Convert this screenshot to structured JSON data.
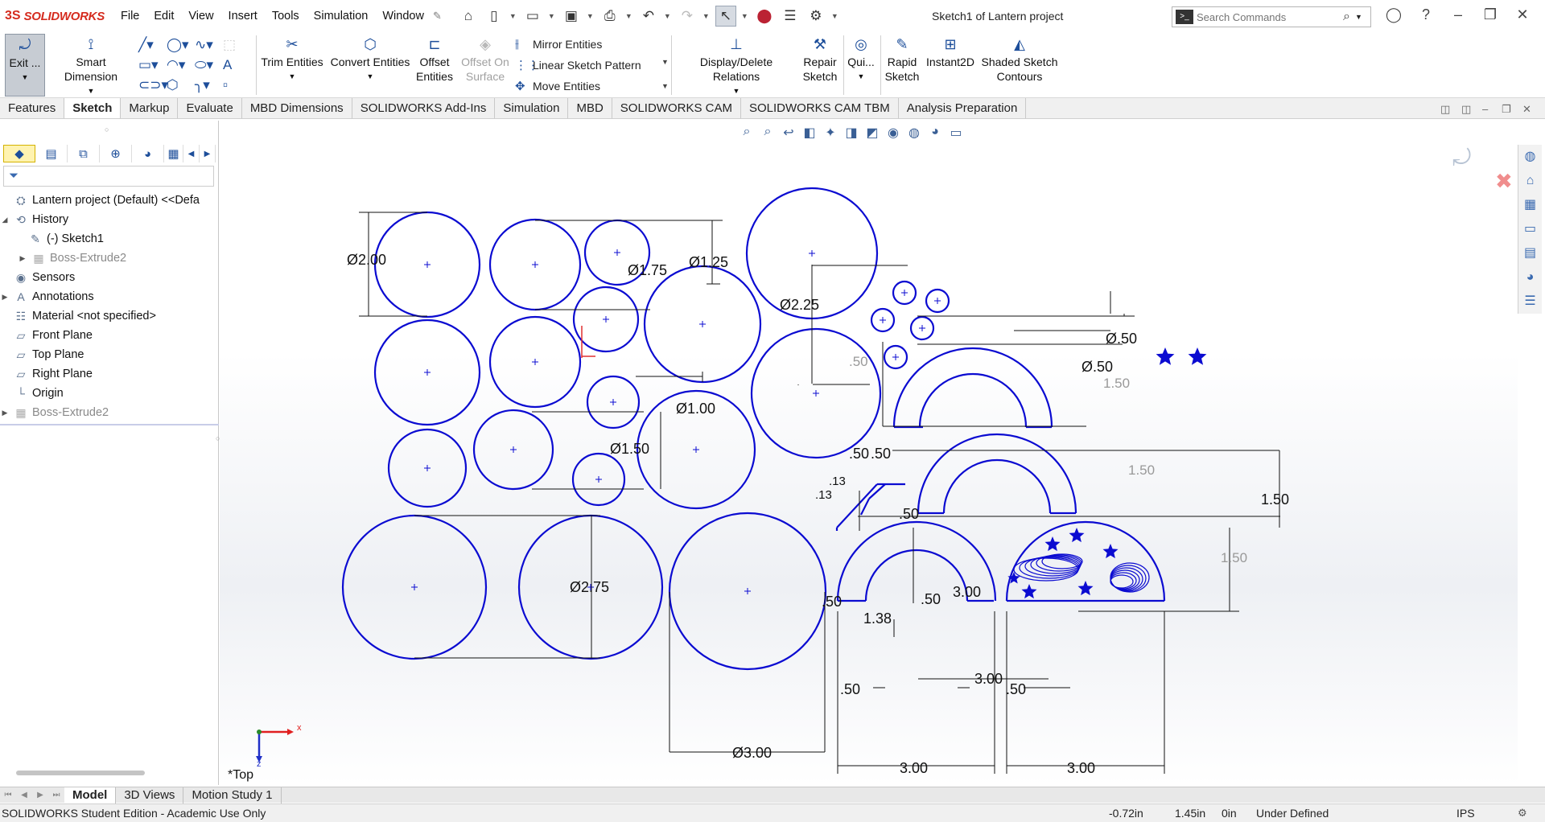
{
  "app": {
    "brand": "SOLIDWORKS",
    "document_title": "Sketch1 of Lantern project"
  },
  "menu": [
    "File",
    "Edit",
    "View",
    "Insert",
    "Tools",
    "Simulation",
    "Window"
  ],
  "search": {
    "placeholder": "Search Commands"
  },
  "ribbon": {
    "exit_sketch": "Exit ...",
    "smart_dimension": "Smart Dimension",
    "trim_entities": "Trim Entities",
    "convert_entities": "Convert Entities",
    "offset_entities": "Offset Entities",
    "offset_on_surface": "Offset On Surface",
    "mirror_entities": "Mirror Entities",
    "linear_sketch_pattern": "Linear Sketch Pattern",
    "move_entities": "Move Entities",
    "display_delete_relations": "Display/Delete Relations",
    "repair_sketch": "Repair Sketch",
    "quick_snaps": "Qui...",
    "rapid_sketch": "Rapid Sketch",
    "instant2d": "Instant2D",
    "shaded_sketch_contours": "Shaded Sketch Contours"
  },
  "tabs": [
    "Features",
    "Sketch",
    "Markup",
    "Evaluate",
    "MBD Dimensions",
    "SOLIDWORKS Add-Ins",
    "Simulation",
    "MBD",
    "SOLIDWORKS CAM",
    "SOLIDWORKS CAM TBM",
    "Analysis Preparation"
  ],
  "active_tab": "Sketch",
  "tree": {
    "root": "Lantern project (Default) <<Defa",
    "history": "History",
    "sketch1": "(-) Sketch1",
    "boss_extrude_hist": "Boss-Extrude2",
    "sensors": "Sensors",
    "annotations": "Annotations",
    "material": "Material <not specified>",
    "front_plane": "Front Plane",
    "top_plane": "Top Plane",
    "right_plane": "Right Plane",
    "origin": "Origin",
    "boss_extrude": "Boss-Extrude2"
  },
  "sketch": {
    "dims": {
      "d200": "Ø2.00",
      "d175": "Ø1.75",
      "d125": "Ø1.25",
      "d225": "Ø2.25",
      "d100": "Ø1.00",
      "d150": "Ø1.50",
      "d275": "Ø2.75",
      "d300": "Ø3.00",
      "d050a": "Ø.50",
      "d050b": "Ø.50",
      "l150a": "1.50",
      "l150b": "1.50",
      "l150c": "1.50",
      "l150d": "1.50",
      "l050a": ".50",
      "l050b": ".50",
      "l050c": ".50",
      "l050d": ".50",
      "l050e": ".50",
      "l050f": ".50",
      "l050g": ".50",
      "l13": ".13",
      "l13b": ".13",
      "l138": "1.38",
      "l300a": "3.00",
      "l300b": "3.00",
      "l300c": "3.00",
      "l300d": "3.00",
      "l50n": ".50"
    }
  },
  "view_orientation": "*Top",
  "triad": {
    "x": "x",
    "z": "z"
  },
  "bottom_tabs": [
    "Model",
    "3D Views",
    "Motion Study 1"
  ],
  "status": {
    "edition": "SOLIDWORKS Student Edition - Academic Use Only",
    "x": "-0.72in",
    "y": "1.45in",
    "z": "0in",
    "state": "Under Defined",
    "units": "IPS"
  },
  "colors": {
    "sketch_blue": "#0b0bd1",
    "brand_red": "#d52b1e",
    "dim_black": "#111111"
  }
}
